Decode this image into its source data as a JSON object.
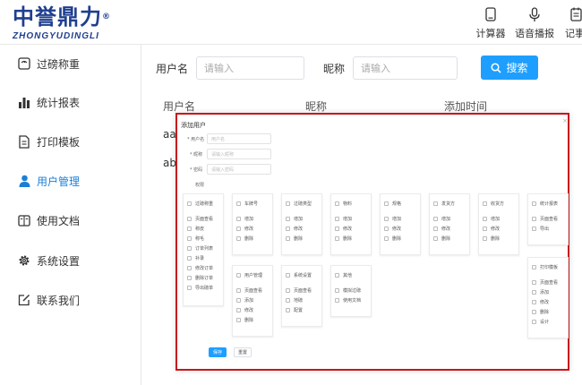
{
  "header": {
    "logo_text": "中誉鼎力",
    "logo_reg": "®",
    "logo_sub": "ZHONGYUDINGLI",
    "tools": [
      {
        "label": "计算器",
        "icon": "calculator-icon"
      },
      {
        "label": "语音播报",
        "icon": "microphone-icon"
      },
      {
        "label": "记事",
        "icon": "notepad-icon"
      }
    ]
  },
  "sidebar": {
    "items": [
      {
        "label": "过磅称重",
        "icon": "scale-icon"
      },
      {
        "label": "统计报表",
        "icon": "bar-chart-icon"
      },
      {
        "label": "打印模板",
        "icon": "document-icon"
      },
      {
        "label": "用户管理",
        "icon": "user-icon",
        "active": true
      },
      {
        "label": "使用文档",
        "icon": "manual-icon"
      },
      {
        "label": "系统设置",
        "icon": "gear-icon"
      },
      {
        "label": "联系我们",
        "icon": "edit-icon"
      }
    ]
  },
  "filter": {
    "username_label": "用户名",
    "username_placeholder": "请输入",
    "nickname_label": "昵称",
    "nickname_placeholder": "请输入",
    "search_label": "搜索"
  },
  "table": {
    "columns": [
      "用户名",
      "昵称",
      "添加时间"
    ],
    "rows": [
      [
        "aa"
      ],
      [
        "ab"
      ]
    ]
  },
  "modal": {
    "title": "添加用户",
    "close": "×",
    "fields": [
      {
        "label": "* 用户名",
        "placeholder": "用户名"
      },
      {
        "label": "* 昵称",
        "placeholder": "请输入昵称"
      },
      {
        "label": "* 密码",
        "placeholder": "请输入密码"
      }
    ],
    "permissions_label": "权限",
    "cards_row1": [
      {
        "title": "过磅称重",
        "items": [
          "页面查看",
          "称皮",
          "称毛",
          "订单列表",
          "补录",
          "修改订单",
          "删除订单",
          "导出磅单"
        ]
      },
      {
        "title": "车牌号",
        "items": [
          "增加",
          "修改",
          "删除"
        ]
      },
      {
        "title": "过磅类型",
        "items": [
          "增加",
          "修改",
          "删除"
        ]
      },
      {
        "title": "物料",
        "items": [
          "增加",
          "修改",
          "删除"
        ]
      },
      {
        "title": "规格",
        "items": [
          "增加",
          "修改",
          "删除"
        ]
      },
      {
        "title": "发货方",
        "items": [
          "增加",
          "修改",
          "删除"
        ]
      },
      {
        "title": "收货方",
        "items": [
          "增加",
          "修改",
          "删除"
        ]
      },
      {
        "title": "统计报表",
        "items": [
          "页面查看",
          "导出"
        ]
      }
    ],
    "cards_row2": [
      {
        "title": "用户管理",
        "items": [
          "页面查看",
          "添加",
          "修改",
          "删除"
        ]
      },
      {
        "title": "系统设置",
        "items": [
          "页面查看",
          "地磅",
          "配置"
        ]
      },
      {
        "title": "其他",
        "items": [
          "模拟过磅",
          "使用文档"
        ]
      },
      {
        "title": "打印模板",
        "items": [
          "页面查看",
          "添加",
          "修改",
          "删除",
          "设计"
        ]
      }
    ],
    "save_label": "保存",
    "reset_label": "重置"
  },
  "colors": {
    "brand": "#1f3f8f",
    "accent": "#1e9fff",
    "active_nav": "#1b7fd8",
    "highlight_border": "#c8161d"
  }
}
